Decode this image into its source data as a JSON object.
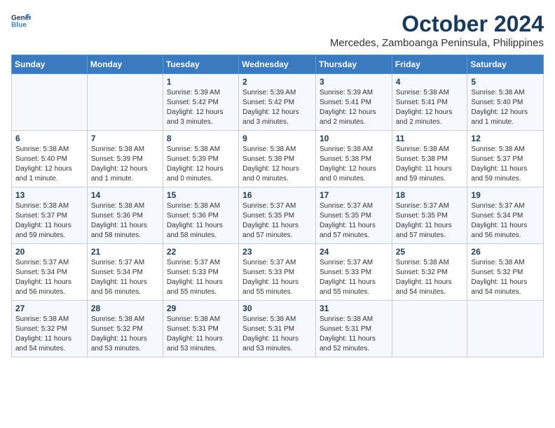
{
  "header": {
    "logo_general": "General",
    "logo_blue": "Blue",
    "title": "October 2024",
    "subtitle": "Mercedes, Zamboanga Peninsula, Philippines"
  },
  "columns": [
    "Sunday",
    "Monday",
    "Tuesday",
    "Wednesday",
    "Thursday",
    "Friday",
    "Saturday"
  ],
  "weeks": [
    [
      {
        "day": "",
        "sunrise": "",
        "sunset": "",
        "daylight": ""
      },
      {
        "day": "",
        "sunrise": "",
        "sunset": "",
        "daylight": ""
      },
      {
        "day": "1",
        "sunrise": "Sunrise: 5:39 AM",
        "sunset": "Sunset: 5:42 PM",
        "daylight": "Daylight: 12 hours and 3 minutes."
      },
      {
        "day": "2",
        "sunrise": "Sunrise: 5:39 AM",
        "sunset": "Sunset: 5:42 PM",
        "daylight": "Daylight: 12 hours and 3 minutes."
      },
      {
        "day": "3",
        "sunrise": "Sunrise: 5:39 AM",
        "sunset": "Sunset: 5:41 PM",
        "daylight": "Daylight: 12 hours and 2 minutes."
      },
      {
        "day": "4",
        "sunrise": "Sunrise: 5:38 AM",
        "sunset": "Sunset: 5:41 PM",
        "daylight": "Daylight: 12 hours and 2 minutes."
      },
      {
        "day": "5",
        "sunrise": "Sunrise: 5:38 AM",
        "sunset": "Sunset: 5:40 PM",
        "daylight": "Daylight: 12 hours and 1 minute."
      }
    ],
    [
      {
        "day": "6",
        "sunrise": "Sunrise: 5:38 AM",
        "sunset": "Sunset: 5:40 PM",
        "daylight": "Daylight: 12 hours and 1 minute."
      },
      {
        "day": "7",
        "sunrise": "Sunrise: 5:38 AM",
        "sunset": "Sunset: 5:39 PM",
        "daylight": "Daylight: 12 hours and 1 minute."
      },
      {
        "day": "8",
        "sunrise": "Sunrise: 5:38 AM",
        "sunset": "Sunset: 5:39 PM",
        "daylight": "Daylight: 12 hours and 0 minutes."
      },
      {
        "day": "9",
        "sunrise": "Sunrise: 5:38 AM",
        "sunset": "Sunset: 5:38 PM",
        "daylight": "Daylight: 12 hours and 0 minutes."
      },
      {
        "day": "10",
        "sunrise": "Sunrise: 5:38 AM",
        "sunset": "Sunset: 5:38 PM",
        "daylight": "Daylight: 12 hours and 0 minutes."
      },
      {
        "day": "11",
        "sunrise": "Sunrise: 5:38 AM",
        "sunset": "Sunset: 5:38 PM",
        "daylight": "Daylight: 11 hours and 59 minutes."
      },
      {
        "day": "12",
        "sunrise": "Sunrise: 5:38 AM",
        "sunset": "Sunset: 5:37 PM",
        "daylight": "Daylight: 11 hours and 59 minutes."
      }
    ],
    [
      {
        "day": "13",
        "sunrise": "Sunrise: 5:38 AM",
        "sunset": "Sunset: 5:37 PM",
        "daylight": "Daylight: 11 hours and 59 minutes."
      },
      {
        "day": "14",
        "sunrise": "Sunrise: 5:38 AM",
        "sunset": "Sunset: 5:36 PM",
        "daylight": "Daylight: 11 hours and 58 minutes."
      },
      {
        "day": "15",
        "sunrise": "Sunrise: 5:38 AM",
        "sunset": "Sunset: 5:36 PM",
        "daylight": "Daylight: 11 hours and 58 minutes."
      },
      {
        "day": "16",
        "sunrise": "Sunrise: 5:37 AM",
        "sunset": "Sunset: 5:35 PM",
        "daylight": "Daylight: 11 hours and 57 minutes."
      },
      {
        "day": "17",
        "sunrise": "Sunrise: 5:37 AM",
        "sunset": "Sunset: 5:35 PM",
        "daylight": "Daylight: 11 hours and 57 minutes."
      },
      {
        "day": "18",
        "sunrise": "Sunrise: 5:37 AM",
        "sunset": "Sunset: 5:35 PM",
        "daylight": "Daylight: 11 hours and 57 minutes."
      },
      {
        "day": "19",
        "sunrise": "Sunrise: 5:37 AM",
        "sunset": "Sunset: 5:34 PM",
        "daylight": "Daylight: 11 hours and 56 minutes."
      }
    ],
    [
      {
        "day": "20",
        "sunrise": "Sunrise: 5:37 AM",
        "sunset": "Sunset: 5:34 PM",
        "daylight": "Daylight: 11 hours and 56 minutes."
      },
      {
        "day": "21",
        "sunrise": "Sunrise: 5:37 AM",
        "sunset": "Sunset: 5:34 PM",
        "daylight": "Daylight: 11 hours and 56 minutes."
      },
      {
        "day": "22",
        "sunrise": "Sunrise: 5:37 AM",
        "sunset": "Sunset: 5:33 PM",
        "daylight": "Daylight: 11 hours and 55 minutes."
      },
      {
        "day": "23",
        "sunrise": "Sunrise: 5:37 AM",
        "sunset": "Sunset: 5:33 PM",
        "daylight": "Daylight: 11 hours and 55 minutes."
      },
      {
        "day": "24",
        "sunrise": "Sunrise: 5:37 AM",
        "sunset": "Sunset: 5:33 PM",
        "daylight": "Daylight: 11 hours and 55 minutes."
      },
      {
        "day": "25",
        "sunrise": "Sunrise: 5:38 AM",
        "sunset": "Sunset: 5:32 PM",
        "daylight": "Daylight: 11 hours and 54 minutes."
      },
      {
        "day": "26",
        "sunrise": "Sunrise: 5:38 AM",
        "sunset": "Sunset: 5:32 PM",
        "daylight": "Daylight: 11 hours and 54 minutes."
      }
    ],
    [
      {
        "day": "27",
        "sunrise": "Sunrise: 5:38 AM",
        "sunset": "Sunset: 5:32 PM",
        "daylight": "Daylight: 11 hours and 54 minutes."
      },
      {
        "day": "28",
        "sunrise": "Sunrise: 5:38 AM",
        "sunset": "Sunset: 5:32 PM",
        "daylight": "Daylight: 11 hours and 53 minutes."
      },
      {
        "day": "29",
        "sunrise": "Sunrise: 5:38 AM",
        "sunset": "Sunset: 5:31 PM",
        "daylight": "Daylight: 11 hours and 53 minutes."
      },
      {
        "day": "30",
        "sunrise": "Sunrise: 5:38 AM",
        "sunset": "Sunset: 5:31 PM",
        "daylight": "Daylight: 11 hours and 53 minutes."
      },
      {
        "day": "31",
        "sunrise": "Sunrise: 5:38 AM",
        "sunset": "Sunset: 5:31 PM",
        "daylight": "Daylight: 11 hours and 52 minutes."
      },
      {
        "day": "",
        "sunrise": "",
        "sunset": "",
        "daylight": ""
      },
      {
        "day": "",
        "sunrise": "",
        "sunset": "",
        "daylight": ""
      }
    ]
  ]
}
